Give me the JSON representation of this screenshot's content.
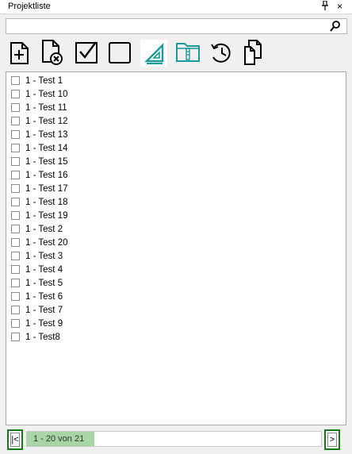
{
  "window": {
    "title": "Projektliste",
    "pin_glyph": "⫯",
    "close_glyph": "×"
  },
  "search": {
    "value": "",
    "placeholder": "",
    "icon": "search-icon"
  },
  "toolbar": {
    "buttons": [
      {
        "name": "new-project",
        "icon": "file-add-icon"
      },
      {
        "name": "delete-project",
        "icon": "file-delete-icon"
      },
      {
        "name": "select-all",
        "icon": "checkbox-checked-icon"
      },
      {
        "name": "deselect-all",
        "icon": "checkbox-empty-icon"
      },
      {
        "name": "edit-project",
        "icon": "drafting-triangle-icon"
      },
      {
        "name": "archive-project",
        "icon": "zip-folder-icon"
      },
      {
        "name": "history",
        "icon": "history-icon"
      },
      {
        "name": "copy-project",
        "icon": "copy-icon"
      }
    ],
    "accent_color": "#1a9a9a"
  },
  "projects": [
    {
      "label": "1 - Test 1",
      "checked": false
    },
    {
      "label": "1 - Test 10",
      "checked": false
    },
    {
      "label": "1 - Test 11",
      "checked": false
    },
    {
      "label": "1 - Test 12",
      "checked": false
    },
    {
      "label": "1 - Test 13",
      "checked": false
    },
    {
      "label": "1 - Test 14",
      "checked": false
    },
    {
      "label": "1 - Test 15",
      "checked": false
    },
    {
      "label": "1 - Test 16",
      "checked": false
    },
    {
      "label": "1 - Test 17",
      "checked": false
    },
    {
      "label": "1 - Test 18",
      "checked": false
    },
    {
      "label": "1 - Test 19",
      "checked": false
    },
    {
      "label": "1 - Test 2",
      "checked": false
    },
    {
      "label": "1 - Test 20",
      "checked": false
    },
    {
      "label": "1 - Test 3",
      "checked": false
    },
    {
      "label": "1 - Test 4",
      "checked": false
    },
    {
      "label": "1 - Test 5",
      "checked": false
    },
    {
      "label": "1 - Test 6",
      "checked": false
    },
    {
      "label": "1 - Test 7",
      "checked": false
    },
    {
      "label": "1 - Test 9",
      "checked": false
    },
    {
      "label": "1 - Test8",
      "checked": false
    }
  ],
  "pager": {
    "first_label": "|<",
    "next_label": ">",
    "status_text": "1 - 20 von 21",
    "progress_fraction": 0.23,
    "highlight_color": "#0f7a17",
    "fill_color": "#a7d5a5"
  }
}
